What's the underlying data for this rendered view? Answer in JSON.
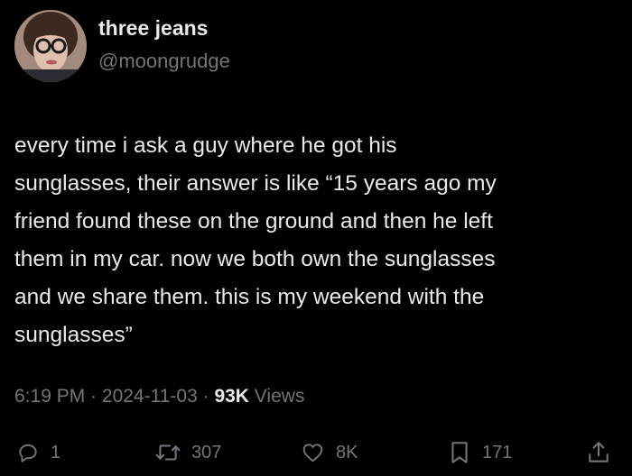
{
  "author": {
    "display_name": "three jeans",
    "handle": "@moongrudge"
  },
  "tweet": {
    "text": "every time i ask a guy where he got his\nsunglasses, their answer is like “15 years ago my\nfriend found these on the ground and then he left\nthem in my car. now we both own the sunglasses\nand we share them. this is my weekend with the\nsunglasses”"
  },
  "meta": {
    "time": "6:19 PM",
    "separator": " · ",
    "date": "2024-11-03",
    "views_count": "93K",
    "views_label": " Views"
  },
  "actions": {
    "replies": "1",
    "retweets": "307",
    "likes": "8K",
    "bookmarks": "171"
  },
  "icons": {
    "reply": "reply-icon",
    "retweet": "retweet-icon",
    "like": "heart-icon",
    "bookmark": "bookmark-icon",
    "share": "share-icon"
  },
  "colors": {
    "background": "#000000",
    "primary_text": "#e7e9ea",
    "secondary_text": "#71767b"
  }
}
